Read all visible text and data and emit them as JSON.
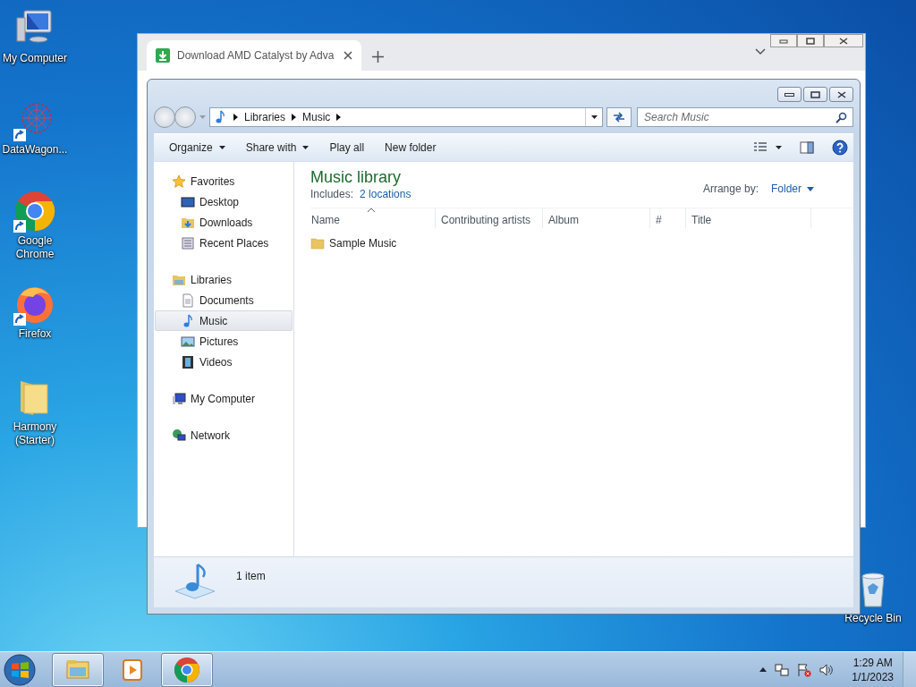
{
  "desktop_icons": [
    {
      "kind": "computer",
      "label": "My Computer",
      "shortcut": false
    },
    {
      "kind": "web",
      "label": "DataWagon...",
      "shortcut": true
    },
    {
      "kind": "chrome",
      "label": "Google Chrome",
      "shortcut": true
    },
    {
      "kind": "firefox",
      "label": "Firefox",
      "shortcut": true
    },
    {
      "kind": "folder",
      "label": "Harmony (Starter)",
      "shortcut": false
    },
    {
      "kind": "recycle",
      "label": "Recycle Bin",
      "shortcut": false
    }
  ],
  "browser": {
    "tab_title": "Download AMD Catalyst by Adva"
  },
  "explorer": {
    "breadcrumb": [
      "Libraries",
      "Music"
    ],
    "search": {
      "placeholder": "Search Music"
    },
    "toolbar": [
      {
        "label": "Organize",
        "dropdown": true
      },
      {
        "label": "Share with",
        "dropdown": true
      },
      {
        "label": "Play all",
        "dropdown": false
      },
      {
        "label": "New folder",
        "dropdown": false
      }
    ],
    "navigation": [
      {
        "label": "Favorites",
        "selected": false,
        "children": [
          {
            "label": "Desktop",
            "selected": false
          },
          {
            "label": "Downloads",
            "selected": false
          },
          {
            "label": "Recent Places",
            "selected": false
          }
        ]
      },
      {
        "label": "Libraries",
        "selected": false,
        "children": [
          {
            "label": "Documents",
            "selected": false
          },
          {
            "label": "Music",
            "selected": true
          },
          {
            "label": "Pictures",
            "selected": false
          },
          {
            "label": "Videos",
            "selected": false
          }
        ]
      },
      {
        "label": "My Computer",
        "selected": false
      },
      {
        "label": "Network",
        "selected": false
      }
    ],
    "heading": "Music library",
    "includes_label": "Includes:",
    "includes_link": "2 locations",
    "arrange_label": "Arrange by:",
    "arrange_value": "Folder",
    "columns": [
      "Name",
      "Contributing artists",
      "Album",
      "#",
      "Title"
    ],
    "items": [
      {
        "name": "Sample Music",
        "selected": false
      }
    ],
    "status": "1 item"
  },
  "taskbar": {
    "buttons": [
      {
        "kind": "explorer",
        "open": true
      },
      {
        "kind": "media",
        "open": false
      },
      {
        "kind": "chrome",
        "open": true
      }
    ],
    "time": "1:29 AM",
    "date": "1/1/2023"
  }
}
